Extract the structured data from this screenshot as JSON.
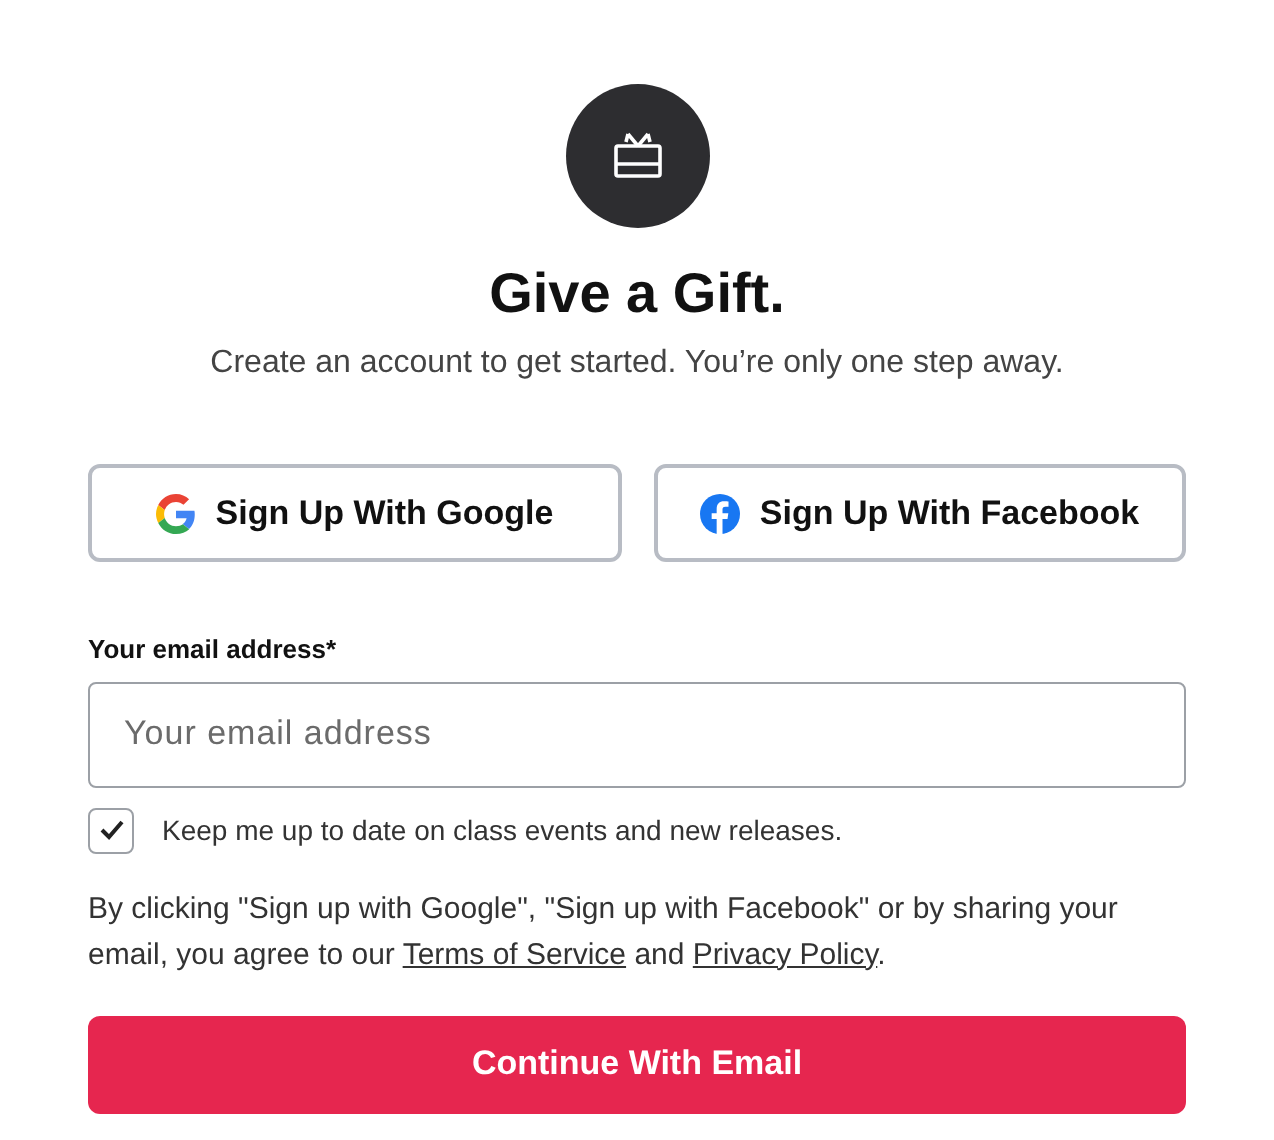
{
  "title": "Give a Gift.",
  "subtitle": "Create an account to get started. You’re only one step away.",
  "social_buttons": [
    {
      "kind": "google",
      "label": "Sign Up With Google"
    },
    {
      "kind": "facebook",
      "label": "Sign Up With Facebook"
    }
  ],
  "email": {
    "label": "Your email address*",
    "placeholder": "Your email address"
  },
  "newsletter": {
    "label": "Keep me up to date on class events and new releases.",
    "checked": true
  },
  "legal": {
    "before": "By clicking \"Sign up with Google\", \"Sign up with Facebook\" or by sharing your email, you agree to our",
    "link_1": "Terms of Service",
    "middle": "and",
    "link_2": "Privacy Policy",
    "after": "."
  },
  "submit": "Continue With Email"
}
